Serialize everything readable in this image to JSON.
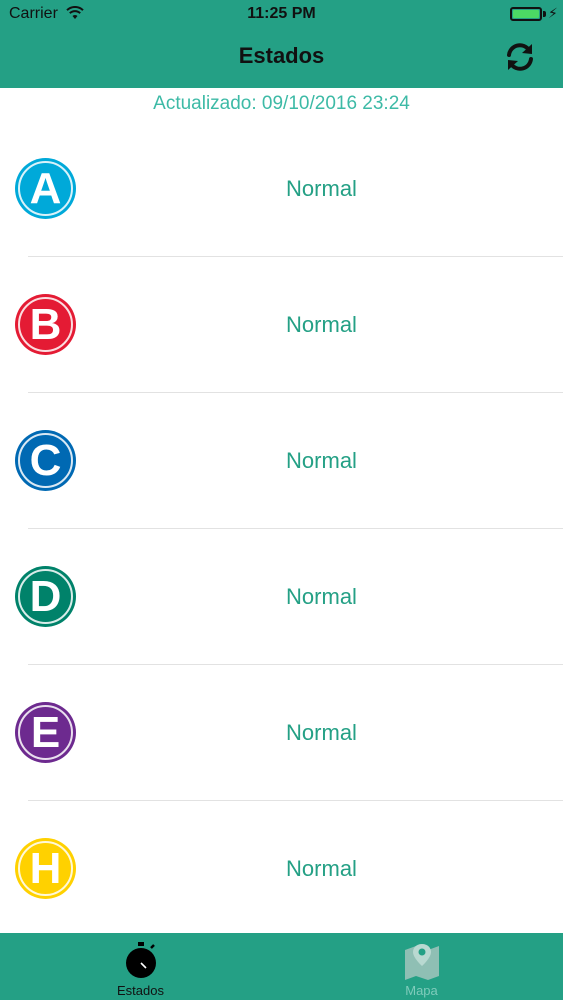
{
  "status_bar": {
    "carrier": "Carrier",
    "time": "11:25 PM"
  },
  "nav": {
    "title": "Estados",
    "refresh_icon": "refresh-icon"
  },
  "updated_text": "Actualizado: 09/10/2016 23:24",
  "lines": [
    {
      "letter": "A",
      "status": "Normal",
      "color": "#00a9d9"
    },
    {
      "letter": "B",
      "status": "Normal",
      "color": "#e41b34"
    },
    {
      "letter": "C",
      "status": "Normal",
      "color": "#0069b3"
    },
    {
      "letter": "D",
      "status": "Normal",
      "color": "#00826a"
    },
    {
      "letter": "E",
      "status": "Normal",
      "color": "#6d2a8f"
    },
    {
      "letter": "H",
      "status": "Normal",
      "color": "#ffd100"
    }
  ],
  "tabs": [
    {
      "label": "Estados",
      "icon": "stopwatch-icon",
      "active": true
    },
    {
      "label": "Mapa",
      "icon": "map-pin-icon",
      "active": false
    }
  ],
  "colors": {
    "accent": "#24a085",
    "updated_text": "#3dbaa6"
  }
}
